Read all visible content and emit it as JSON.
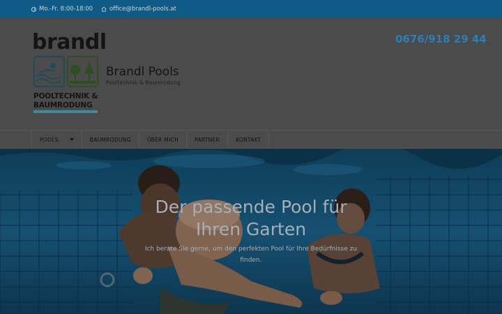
{
  "topbar": {
    "hours": "Mo.-Fr. 8:00-18:00",
    "email": "office@brandl-pools.at",
    "hours_icon": "clock-icon",
    "email_icon": "home-icon"
  },
  "header": {
    "logo": {
      "word": "brandl",
      "line1": "POOLTECHNIK &",
      "line2": "BAUMRODUNG"
    },
    "site_title": "Brandl Pools",
    "site_subtitle": "Pooltechnik & Baumrodung",
    "phone": "0676/918 29 44"
  },
  "nav": {
    "items": [
      {
        "label": "POOLS",
        "has_dropdown": true
      },
      {
        "label": "BAUMRODUNG"
      },
      {
        "label": "ÜBER MICH"
      },
      {
        "label": "PARTNER"
      },
      {
        "label": "KONTAKT"
      }
    ]
  },
  "hero": {
    "title_line1": "Der passende Pool für",
    "title_line2": "Ihren Garten",
    "subtitle_line1": "Ich berate Sie gerne, um den perfekten Pool für Ihre Bedürfnisse zu",
    "subtitle_line2": "finden."
  },
  "colors": {
    "topbar": "#0f5a86",
    "phone": "#2e7eb5",
    "overlay_header": "#4b4b4b",
    "water": "#1a6a9c"
  }
}
